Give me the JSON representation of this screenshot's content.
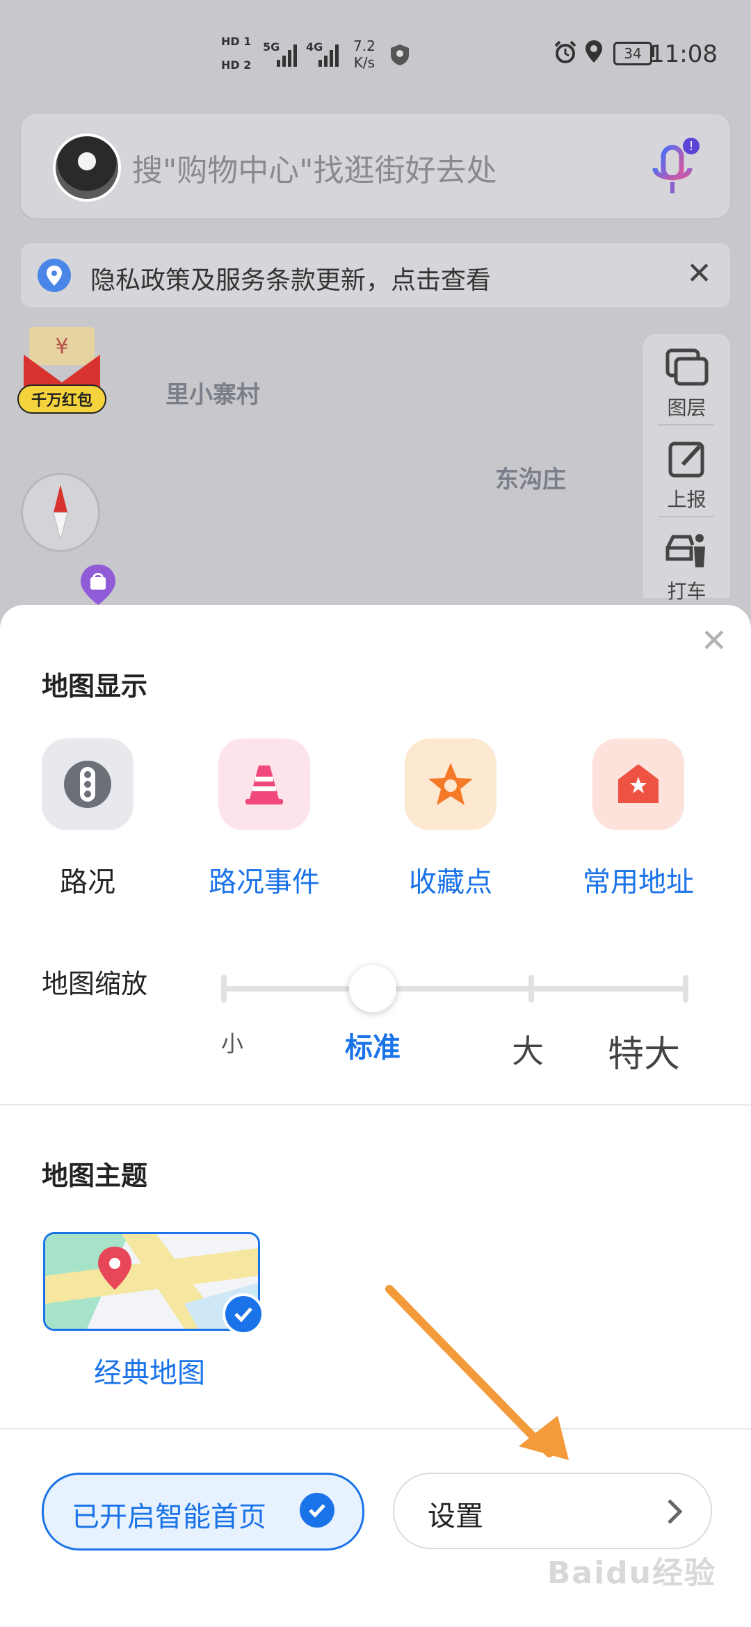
{
  "status_bar": {
    "hd1": "HD 1",
    "hd2": "HD 2",
    "net5g": "5G",
    "net4g": "4G",
    "speed_value": "7.2",
    "speed_unit": "K/s",
    "battery": "34",
    "time": "11:08"
  },
  "search": {
    "placeholder": "搜\"购物中心\"找逛街好去处"
  },
  "notice": {
    "text": "隐私政策及服务条款更新，点击查看"
  },
  "map": {
    "labels": [
      "里小寨村",
      "东沟庄"
    ],
    "hongbao_label": "千万红包"
  },
  "tools": [
    {
      "label": "图层"
    },
    {
      "label": "上报"
    },
    {
      "label": "打车"
    }
  ],
  "sheet": {
    "map_display_title": "地图显示",
    "options": [
      {
        "label": "路况",
        "icon": "traffic-light-icon",
        "active": false
      },
      {
        "label": "路况事件",
        "icon": "traffic-cone-icon",
        "active": true
      },
      {
        "label": "收藏点",
        "icon": "star-icon",
        "active": true
      },
      {
        "label": "常用地址",
        "icon": "home-icon",
        "active": true
      }
    ],
    "zoom_title": "地图缩放",
    "zoom_levels": [
      "小",
      "标准",
      "大",
      "特大"
    ],
    "zoom_selected_index": 1,
    "theme_title": "地图主题",
    "theme_name": "经典地图",
    "smart_home_label": "已开启智能首页",
    "settings_label": "设置"
  },
  "watermark": "Baidu经验",
  "colors": {
    "accent": "#1a73e8",
    "arrow": "#f39a3a"
  }
}
